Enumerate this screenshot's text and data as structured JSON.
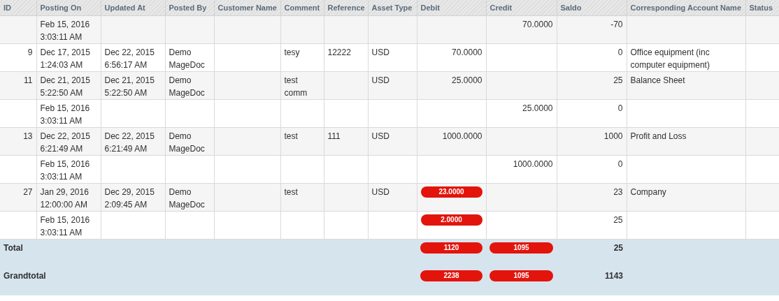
{
  "table": {
    "columns": [
      "ID",
      "Posting On",
      "Updated At",
      "Posted By",
      "Customer Name",
      "Comment",
      "Reference",
      "Asset Type",
      "Debit",
      "Credit",
      "Saldo",
      "Corresponding Account Name",
      "Status"
    ],
    "rows": [
      {
        "posting_on": "Feb 15, 2016 3:03:11 AM",
        "credit": "70.0000",
        "saldo": "-70"
      },
      {
        "id": "9",
        "posting_on": "Dec 17, 2015 1:24:03 AM",
        "updated_at": "Dec 22, 2015 6:56:17 AM",
        "posted_by": "Demo MageDoc",
        "comment": "tesy",
        "reference": "12222",
        "asset_type": "USD",
        "debit": "70.0000",
        "debit_flagged": false,
        "saldo": "0",
        "account": "Office equipment (inc computer equipment)"
      },
      {
        "id": "11",
        "posting_on": "Dec 21, 2015 5:22:50 AM",
        "updated_at": "Dec 21, 2015 5:22:50 AM",
        "posted_by": "Demo MageDoc",
        "comment": "test comm",
        "asset_type": "USD",
        "debit": "25.0000",
        "debit_flagged": false,
        "saldo": "25",
        "account": "Balance Sheet"
      },
      {
        "posting_on": "Feb 15, 2016 3:03:11 AM",
        "credit": "25.0000",
        "saldo": "0"
      },
      {
        "id": "13",
        "posting_on": "Dec 22, 2015 6:21:49 AM",
        "updated_at": "Dec 22, 2015 6:21:49 AM",
        "posted_by": "Demo MageDoc",
        "comment": "test",
        "reference": "111",
        "asset_type": "USD",
        "debit": "1000.0000",
        "debit_flagged": false,
        "saldo": "1000",
        "account": "Profit and Loss"
      },
      {
        "posting_on": "Feb 15, 2016 3:03:11 AM",
        "credit": "1000.0000",
        "saldo": "0"
      },
      {
        "id": "27",
        "posting_on": "Jan 29, 2016 12:00:00 AM",
        "updated_at": "Dec 29, 2015 2:09:45 AM",
        "posted_by": "Demo MageDoc",
        "comment": "test",
        "asset_type": "USD",
        "debit": "23.0000",
        "debit_flagged": true,
        "saldo": "23",
        "account": "Company"
      },
      {
        "posting_on": "Feb 15, 2016 3:03:11 AM",
        "debit": "2.0000",
        "debit_flagged": true,
        "saldo": "25"
      }
    ],
    "totals": [
      {
        "label": "Total",
        "debit": "1120",
        "credit": "1095",
        "saldo": "25"
      },
      {
        "label": "Grandtotal",
        "debit": "2238",
        "credit": "1095",
        "saldo": "1143"
      }
    ]
  }
}
